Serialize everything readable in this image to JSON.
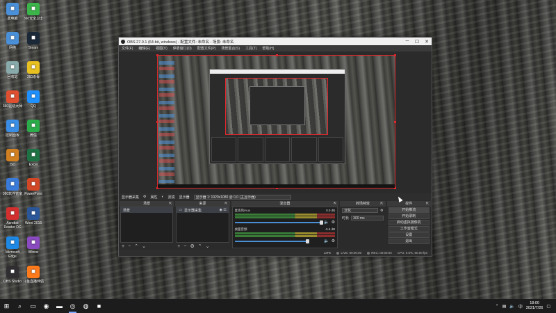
{
  "desktop": {
    "icons": [
      {
        "label": "此电脑",
        "icon": "computer-icon",
        "color": "#4a90d9"
      },
      {
        "label": "360安全卫士",
        "icon": "shield-icon",
        "color": "#3bb54a"
      },
      {
        "label": "网络",
        "icon": "network-icon",
        "color": "#4a90d9"
      },
      {
        "label": "Steam",
        "icon": "steam-icon",
        "color": "#1b2838"
      },
      {
        "label": "回收站",
        "icon": "recycle-bin-icon",
        "color": "#8aa"
      },
      {
        "label": "360杀毒",
        "icon": "antivirus-icon",
        "color": "#e8c020"
      },
      {
        "label": "360驱动大师",
        "icon": "driver-icon",
        "color": "#e05030"
      },
      {
        "label": "QQ",
        "icon": "qq-icon",
        "color": "#1e90ff"
      },
      {
        "label": "控制面板",
        "icon": "control-panel-icon",
        "color": "#3a8ee6"
      },
      {
        "label": "微信",
        "icon": "wechat-icon",
        "color": "#2bad4a"
      },
      {
        "label": "ISO",
        "icon": "iso-icon",
        "color": "#d08020"
      },
      {
        "label": "Excel",
        "icon": "excel-icon",
        "color": "#1f7244"
      },
      {
        "label": "360软件管家",
        "icon": "software-icon",
        "color": "#3a7ad9"
      },
      {
        "label": "PowerPoint",
        "icon": "powerpoint-icon",
        "color": "#d24726"
      },
      {
        "label": "Acrobat Reader DC",
        "icon": "pdf-icon",
        "color": "#d32f2f"
      },
      {
        "label": "Word 2016",
        "icon": "word-icon",
        "color": "#2b579a"
      },
      {
        "label": "Microsoft Edge",
        "icon": "edge-icon",
        "color": "#1e88e5"
      },
      {
        "label": "Winrar",
        "icon": "archive-icon",
        "color": "#8a4ac0"
      },
      {
        "label": "OBS Studio",
        "icon": "obs-icon",
        "color": "#302e31"
      },
      {
        "label": "斗鱼直播伴侣",
        "icon": "douyu-icon",
        "color": "#ff7a1a"
      }
    ]
  },
  "obs": {
    "title": "OBS 27.0.1 (64-bit, windows) - 配置文件: 未命名 - 场景: 未命名",
    "menu": [
      "文件(F)",
      "编辑(E)",
      "视图(V)",
      "停靠窗口(D)",
      "配置文件(P)",
      "场景集合(S)",
      "工具(T)",
      "帮助(H)"
    ],
    "toolbar": {
      "source_name": "显示器采集",
      "properties_label": "属性",
      "filters_label": "滤镜",
      "display_label": "显示器",
      "display_value": "显示器 1: 1920x1080 @ 0,0 (主显示器)"
    },
    "docks": {
      "scenes": {
        "title": "场景",
        "items": [
          "场景"
        ]
      },
      "sources": {
        "title": "来源",
        "items": [
          "显示器采集"
        ]
      },
      "mixer": {
        "title": "混音器",
        "tracks": [
          {
            "name": "麦克风/Aux",
            "level": "0.0 dB"
          },
          {
            "name": "桌面音频",
            "level": "-5.6 dB"
          }
        ]
      },
      "transitions": {
        "title": "转场特效",
        "type": "淡化",
        "duration_label": "时长",
        "duration_value": "300 ms"
      },
      "controls": {
        "title": "控件",
        "buttons": [
          "开始推流",
          "开始录制",
          "启动虚拟摄像机",
          "工作室模式",
          "设置",
          "退出"
        ]
      }
    },
    "status": {
      "live": "LIVE: 00:00:00",
      "rec": "REC: 00:00:00",
      "cpu": "CPU: 0.6%, 60.00 fps",
      "dropped": "12FE"
    }
  },
  "taskbar": {
    "start_icon": "windows-icon",
    "apps": [
      {
        "name": "search",
        "icon": "search-icon",
        "glyph": "⌕"
      },
      {
        "name": "task-view",
        "icon": "task-view-icon",
        "glyph": "▭"
      },
      {
        "name": "edge",
        "icon": "edge-icon",
        "glyph": "◉"
      },
      {
        "name": "file-explorer",
        "icon": "folder-icon",
        "glyph": "▬"
      },
      {
        "name": "obs",
        "icon": "obs-icon",
        "glyph": "◎",
        "open": true
      },
      {
        "name": "steam",
        "icon": "steam-icon",
        "glyph": "◍"
      },
      {
        "name": "douyu",
        "icon": "douyu-icon",
        "glyph": "■"
      }
    ],
    "time": "18:00",
    "date": "2021/7/26"
  }
}
